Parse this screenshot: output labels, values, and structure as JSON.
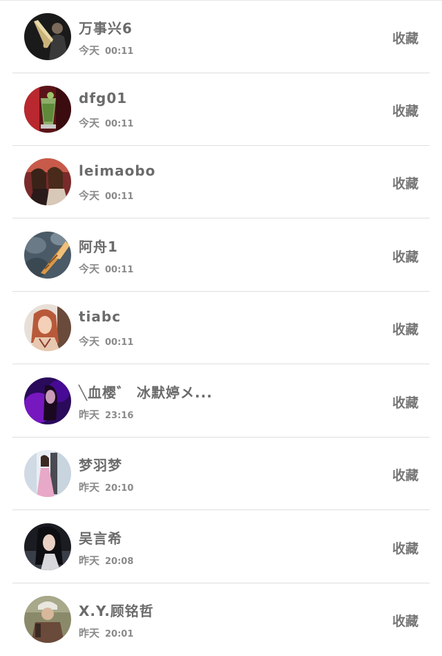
{
  "items": [
    {
      "name": "万事兴6",
      "day": "今天",
      "time": "00:11",
      "action": "收藏",
      "avatar": "saxophone-player-photo"
    },
    {
      "name": "dfg01",
      "day": "今天",
      "time": "00:11",
      "action": "收藏",
      "avatar": "cocktail-drink-photo"
    },
    {
      "name": "leimaobo",
      "day": "今天",
      "time": "00:11",
      "action": "收藏",
      "avatar": "two-girls-photo"
    },
    {
      "name": "阿舟1",
      "day": "今天",
      "time": "00:11",
      "action": "收藏",
      "avatar": "seashell-photo"
    },
    {
      "name": "tiabc",
      "day": "今天",
      "time": "00:11",
      "action": "收藏",
      "avatar": "woman-portrait-photo"
    },
    {
      "name": "╲血樱゛ 冰默婷メ...",
      "day": "昨天",
      "time": "23:16",
      "action": "收藏",
      "avatar": "purple-light-portrait-photo"
    },
    {
      "name": "梦羽梦",
      "day": "昨天",
      "time": "20:10",
      "action": "收藏",
      "avatar": "girl-pink-dress-photo"
    },
    {
      "name": "吴言希",
      "day": "昨天",
      "time": "20:08",
      "action": "收藏",
      "avatar": "dark-hair-girl-photo"
    },
    {
      "name": "X.Y.顾铭哲",
      "day": "昨天",
      "time": "20:01",
      "action": "收藏",
      "avatar": "boy-in-cap-photo"
    }
  ],
  "colors": {
    "text": "#6b6b6b",
    "time": "#8a8a8a",
    "divider": "#dedede"
  }
}
